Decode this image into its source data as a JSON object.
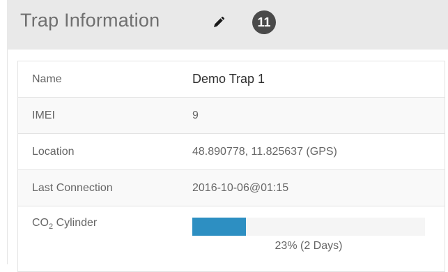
{
  "header": {
    "title": "Trap Information",
    "edit_icon": "pencil-icon",
    "badge": "11"
  },
  "rows": [
    {
      "label": "Name",
      "value": "Demo Trap 1"
    },
    {
      "label": "IMEI",
      "value": "9"
    },
    {
      "label": "Location",
      "value": "48.890778, 11.825637 (GPS)"
    },
    {
      "label": "Last Connection",
      "value": "2016-10-06@01:15"
    }
  ],
  "co2": {
    "label_prefix": "CO",
    "label_sub": "2",
    "label_suffix": " Cylinder",
    "fill_percent": 23,
    "text": "23% (2 Days)"
  },
  "colors": {
    "header_bg": "#e9e9e9",
    "badge_bg": "#4a4a4a",
    "progress_fill": "#2d8fc2",
    "progress_track": "#f5f5f5"
  }
}
